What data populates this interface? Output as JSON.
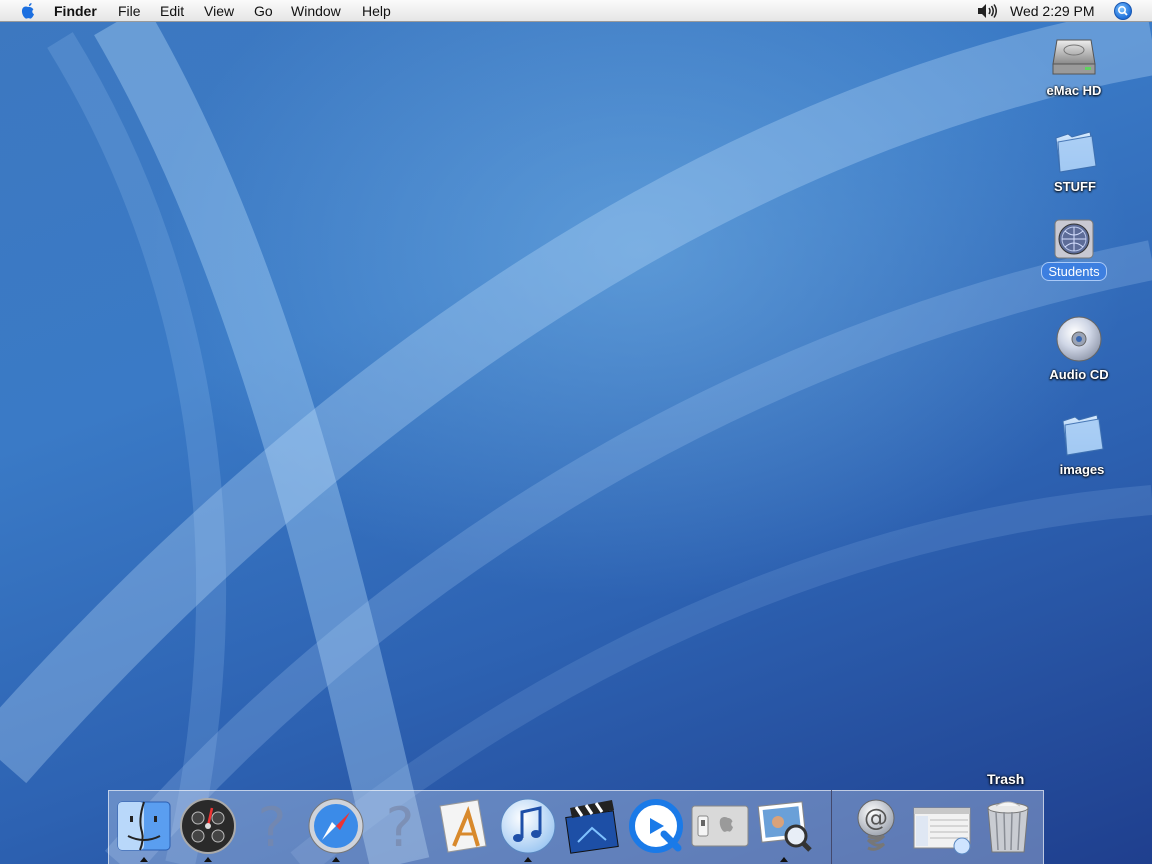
{
  "menubar": {
    "app_name": "Finder",
    "menus": [
      "File",
      "Edit",
      "View",
      "Go",
      "Window",
      "Help"
    ],
    "clock": "Wed 2:29 PM"
  },
  "desktop": {
    "icons": [
      {
        "label": "eMac HD",
        "kind": "hard-disk-icon"
      },
      {
        "label": "STUFF",
        "kind": "folder-icon"
      },
      {
        "label": "Students",
        "kind": "network-volume-icon",
        "selected": true
      },
      {
        "label": "Audio CD",
        "kind": "audio-cd-icon"
      },
      {
        "label": "images",
        "kind": "folder-icon"
      }
    ]
  },
  "dock": {
    "hover_label": "Trash",
    "items": [
      {
        "name": "finder-icon",
        "running": true
      },
      {
        "name": "dashboard-icon",
        "running": true
      },
      {
        "name": "missing-app-icon",
        "running": false
      },
      {
        "name": "safari-icon",
        "running": true
      },
      {
        "name": "missing-app-icon",
        "running": false
      },
      {
        "name": "textedit-icon",
        "running": false
      },
      {
        "name": "itunes-icon",
        "running": true
      },
      {
        "name": "imovie-icon",
        "running": false
      },
      {
        "name": "quicktime-icon",
        "running": false
      },
      {
        "name": "system-preferences-icon",
        "running": false
      },
      {
        "name": "preview-icon",
        "running": true
      },
      {
        "name": "mail-icon",
        "running": false
      },
      {
        "name": "itunes-window-icon",
        "running": false
      },
      {
        "name": "trash-icon",
        "running": false
      }
    ]
  },
  "colors": {
    "menu_bar": "#ececec",
    "wallpaper_blue": "#3a7ac6",
    "selection_blue": "#3d7fe0"
  }
}
